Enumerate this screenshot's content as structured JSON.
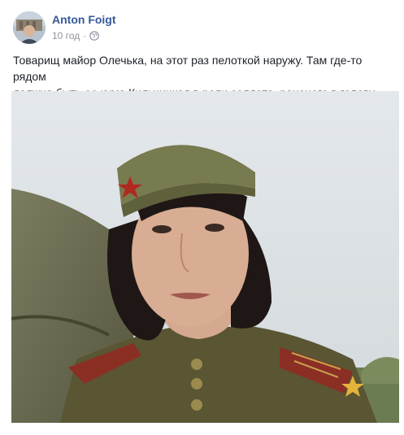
{
  "post": {
    "author": "Anton Foigt",
    "time": "10 год",
    "separator": "·",
    "privacy_icon": "globe-icon",
    "text_lines": [
      "Товарищ майор Олечька, на этот раз пелоткой наружу. Там где-то рядом",
      "должна быть ее кума Кильчицкая в роли солдата, раненого в голову."
    ],
    "image_icon": "photo-of-woman-in-soviet-uniform"
  },
  "colors": {
    "author_link": "#365899",
    "meta_gray": "#90949c",
    "text": "#1d2129"
  }
}
